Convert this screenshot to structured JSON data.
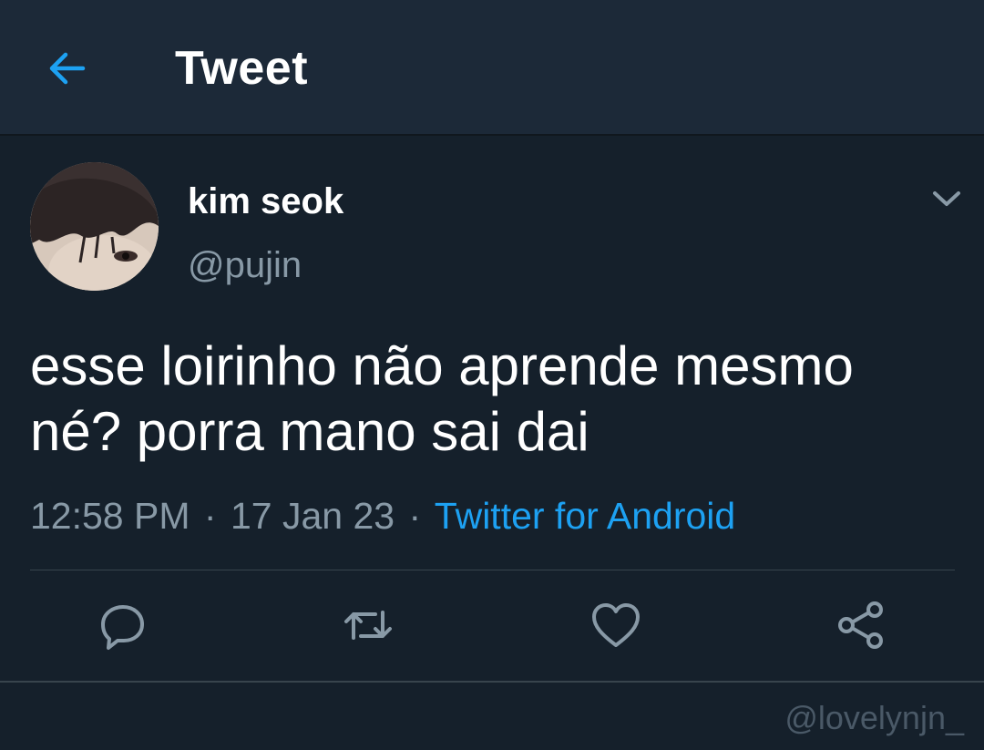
{
  "header": {
    "title": "Tweet",
    "back_icon": "arrow-left-icon"
  },
  "tweet": {
    "author": {
      "display_name": "kim seok",
      "handle": "@pujin"
    },
    "text_lines": [
      "esse loirinho não aprende mesmo",
      "né? porra mano sai dai"
    ],
    "time": "12:58 PM",
    "date": "17 Jan 23",
    "separator": "·",
    "source": "Twitter for Android"
  },
  "actions": [
    {
      "name": "reply",
      "icon": "reply-icon"
    },
    {
      "name": "retweet",
      "icon": "retweet-icon"
    },
    {
      "name": "like",
      "icon": "heart-icon"
    },
    {
      "name": "share",
      "icon": "share-icon"
    }
  ],
  "watermark": "@lovelynjn_",
  "colors": {
    "background": "#15202b",
    "header": "#1c2938",
    "accent": "#1da1f2",
    "secondary_text": "#8899a6",
    "divider": "#38444d"
  }
}
